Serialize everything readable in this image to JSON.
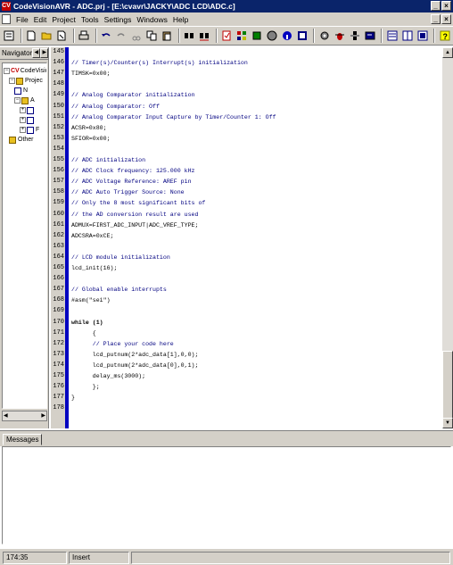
{
  "window": {
    "title": "CodeVisionAVR - ADC.prj - [E:\\cvavr\\JACKY\\ADC LCD\\ADC.c]",
    "app_icon": "CV",
    "buttons": [
      "_",
      "×"
    ]
  },
  "menu": {
    "items": [
      "File",
      "Edit",
      "Project",
      "Tools",
      "Settings",
      "Windows",
      "Help"
    ],
    "mdi_buttons": [
      "_",
      "×"
    ]
  },
  "navigator": {
    "label": "Navigator",
    "tree": [
      {
        "label": "CodeVisio",
        "depth": 0,
        "expander": "−",
        "icon": "cv-icon"
      },
      {
        "label": "Projec",
        "depth": 1,
        "expander": "−",
        "icon": "folder-icon"
      },
      {
        "label": "N",
        "depth": 2,
        "expander": "",
        "icon": "file-icon"
      },
      {
        "label": "A",
        "depth": 2,
        "expander": "−",
        "icon": "folder-icon"
      },
      {
        "label": "",
        "depth": 3,
        "expander": "+",
        "icon": "file-icon"
      },
      {
        "label": "",
        "depth": 3,
        "expander": "+",
        "icon": "file-icon"
      },
      {
        "label": "F",
        "depth": 3,
        "expander": "+",
        "icon": "file-icon"
      },
      {
        "label": "Other",
        "depth": 1,
        "expander": "",
        "icon": "folder-icon"
      }
    ]
  },
  "editor": {
    "lines": [
      {
        "n": "145",
        "text": "",
        "kind": "plain"
      },
      {
        "n": "146",
        "text": "// Timer(s)/Counter(s) Interrupt(s) initialization",
        "kind": "comment"
      },
      {
        "n": "147",
        "text": "TIMSK=0x00;",
        "kind": "plain"
      },
      {
        "n": "148",
        "text": "",
        "kind": "plain"
      },
      {
        "n": "149",
        "text": "// Analog Comparator initialization",
        "kind": "comment"
      },
      {
        "n": "150",
        "text": "// Analog Comparator: Off",
        "kind": "comment"
      },
      {
        "n": "151",
        "text": "// Analog Comparator Input Capture by Timer/Counter 1: Off",
        "kind": "comment"
      },
      {
        "n": "152",
        "text": "ACSR=0x80;",
        "kind": "plain"
      },
      {
        "n": "153",
        "text": "SFIOR=0x00;",
        "kind": "plain"
      },
      {
        "n": "154",
        "text": "",
        "kind": "plain"
      },
      {
        "n": "155",
        "text": "// ADC initialization",
        "kind": "comment"
      },
      {
        "n": "156",
        "text": "// ADC Clock frequency: 125.000 kHz",
        "kind": "comment"
      },
      {
        "n": "157",
        "text": "// ADC Voltage Reference: AREF pin",
        "kind": "comment"
      },
      {
        "n": "158",
        "text": "// ADC Auto Trigger Source: None",
        "kind": "comment"
      },
      {
        "n": "159",
        "text": "// Only the 8 most significant bits of",
        "kind": "comment"
      },
      {
        "n": "160",
        "text": "// the AD conversion result are used",
        "kind": "comment"
      },
      {
        "n": "161",
        "text": "ADMUX=FIRST_ADC_INPUT|ADC_VREF_TYPE;",
        "kind": "plain"
      },
      {
        "n": "162",
        "text": "ADCSRA=0xCE;",
        "kind": "plain"
      },
      {
        "n": "163",
        "text": "",
        "kind": "plain"
      },
      {
        "n": "164",
        "text": "// LCD module initialization",
        "kind": "comment"
      },
      {
        "n": "165",
        "text": "lcd_init(16);",
        "kind": "plain"
      },
      {
        "n": "166",
        "text": "",
        "kind": "plain"
      },
      {
        "n": "167",
        "text": "// Global enable interrupts",
        "kind": "comment"
      },
      {
        "n": "168",
        "text": "#asm(\"sei\")",
        "kind": "plain"
      },
      {
        "n": "169",
        "text": "",
        "kind": "plain"
      },
      {
        "n": "170",
        "text": "while (1)",
        "kind": "keyword"
      },
      {
        "n": "171",
        "text": "      {",
        "kind": "plain"
      },
      {
        "n": "172",
        "text": "      // Place your code here",
        "kind": "comment"
      },
      {
        "n": "173",
        "text": "      lcd_putnum(2*adc_data[1],0,0);",
        "kind": "plain"
      },
      {
        "n": "174",
        "text": "      lcd_putnum(2*adc_data[0],0,1);",
        "kind": "plain"
      },
      {
        "n": "175",
        "text": "      delay_ms(3000);",
        "kind": "plain"
      },
      {
        "n": "176",
        "text": "      };",
        "kind": "plain"
      },
      {
        "n": "177",
        "text": "}",
        "kind": "plain"
      },
      {
        "n": "178",
        "text": "",
        "kind": "plain"
      }
    ]
  },
  "messages": {
    "tab_label": "Messages"
  },
  "status": {
    "position": "174:35",
    "mode": "Insert"
  }
}
